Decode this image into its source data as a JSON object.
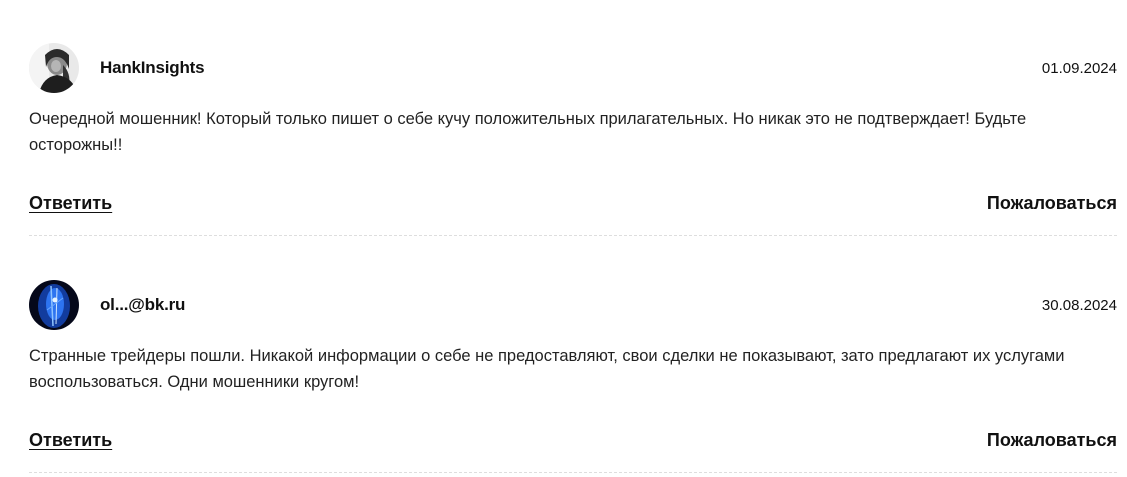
{
  "comments": [
    {
      "author": "HankInsights",
      "avatar_icon": "user-photo-icon",
      "date": "01.09.2024",
      "text": "Очередной мошенник! Который только пишет о себе кучу положительных прилагательных. Но никак это не подтверждает! Будьте осторожны!!",
      "reply_label": "Ответить",
      "report_label": "Пожаловаться"
    },
    {
      "author": "ol...@bk.ru",
      "avatar_icon": "blue-abstract-avatar-icon",
      "date": "30.08.2024",
      "text": "Странные трейдеры пошли. Никакой информации о себе не предоставляют, свои сделки не показывают, зато предлагают их услугами воспользоваться. Одни мошенники кругом!",
      "reply_label": "Ответить",
      "report_label": "Пожаловаться"
    }
  ],
  "colors": {
    "text": "#1a1a1a",
    "divider": "#dedede",
    "avatar2": "#1a4fd8"
  }
}
